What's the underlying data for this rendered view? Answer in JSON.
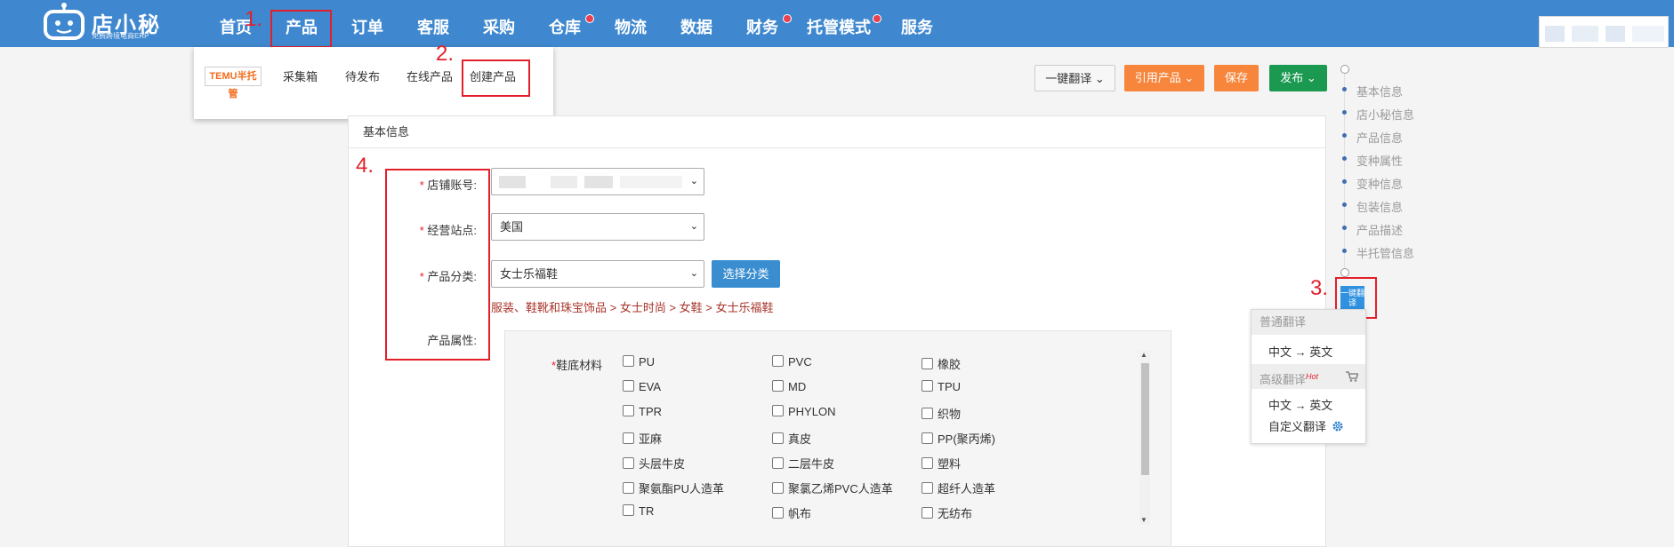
{
  "brand": {
    "name": "店小秘",
    "tagline": "免费跨境电商ERP"
  },
  "nav": [
    {
      "label": "首页"
    },
    {
      "label": "产品"
    },
    {
      "label": "订单"
    },
    {
      "label": "客服"
    },
    {
      "label": "采购"
    },
    {
      "label": "仓库"
    },
    {
      "label": "物流"
    },
    {
      "label": "数据"
    },
    {
      "label": "财务"
    },
    {
      "label": "托管模式"
    },
    {
      "label": "服务"
    }
  ],
  "steps": {
    "s1": "1.",
    "s2": "2.",
    "s3": "3.",
    "s4": "4."
  },
  "dropdown": {
    "temu": "TEMU半托管",
    "items": [
      "采集箱",
      "待发布",
      "在线产品",
      "创建产品"
    ]
  },
  "toolbar": {
    "translate": "一键翻译",
    "quote": "引用产品",
    "save": "保存",
    "publish": "发布"
  },
  "panel": {
    "title": "基本信息"
  },
  "form": {
    "shop_label": "店铺账号:",
    "site_label": "经营站点:",
    "site_value": "美国",
    "category_label": "产品分类:",
    "category_value": "女士乐福鞋",
    "choose_category": "选择分类",
    "breadcrumb": "服装、鞋靴和珠宝饰品  > 女士时尚  > 女鞋  > 女士乐福鞋",
    "attr_label": "产品属性:",
    "required_mark": "*"
  },
  "attributes": {
    "label": "鞋底材料",
    "options": [
      "PU",
      "PVC",
      "橡胶",
      "EVA",
      "MD",
      "TPU",
      "TPR",
      "PHYLON",
      "织物",
      "亚麻",
      "真皮",
      "PP(聚丙烯)",
      "头层牛皮",
      "二层牛皮",
      "塑料",
      "聚氨酯PU人造革",
      "聚氯乙烯PVC人造革",
      "超纤人造革",
      "TR",
      "帆布",
      "无纺布"
    ]
  },
  "side_nav": [
    "基本信息",
    "店小秘信息",
    "产品信息",
    "变种属性",
    "变种信息",
    "包装信息",
    "产品描述",
    "半托管信息"
  ],
  "translate_widget": {
    "button": "一键翻译",
    "normal_head": "普通翻译",
    "normal_item": "中文 → 英文",
    "advanced_head": "高级翻译",
    "hot": "Hot",
    "advanced_item": "中文 → 英文",
    "custom_item": "自定义翻译"
  },
  "colors": {
    "topbar": "#3f88cf",
    "accent_red": "#e3202a",
    "orange": "#f7853b",
    "green": "#1b9951",
    "blue": "#3a8ed0"
  }
}
